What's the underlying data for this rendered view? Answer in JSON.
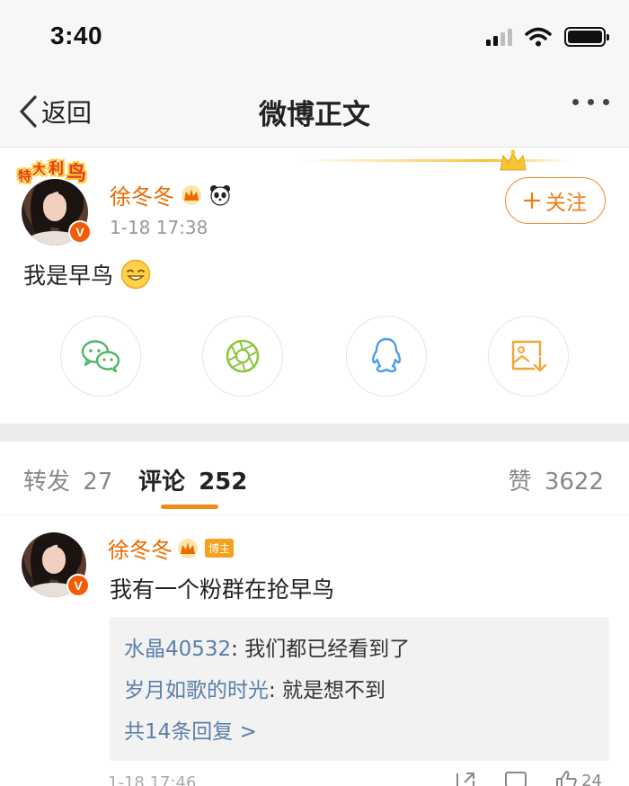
{
  "status_bar": {
    "time": "3:40"
  },
  "header": {
    "back_label": "返回",
    "title": "微博正文"
  },
  "post": {
    "sticker_text": [
      "特",
      "大",
      "利",
      "鸟"
    ],
    "author": "徐冬冬",
    "timestamp": "1-18 17:38",
    "follow_label": "关注",
    "text": "我是早鸟",
    "share_targets": [
      "wechat-icon",
      "moments-icon",
      "qq-icon",
      "save-image-icon"
    ]
  },
  "tabs": {
    "repost_label": "转发",
    "repost_count": "27",
    "comment_label": "评论",
    "comment_count": "252",
    "like_label": "赞",
    "like_count": "3622"
  },
  "comment": {
    "author": "徐冬冬",
    "badge": "博主",
    "text": "我有一个粉群在抢早鸟",
    "replies": [
      {
        "author": "水晶40532",
        "text": ": 我们都已经看到了"
      },
      {
        "author": "岁月如歌的时光",
        "text": ": 就是想不到"
      }
    ],
    "more_replies": "共14条回复 >",
    "timestamp": "1-18 17:46",
    "like_count": "24"
  },
  "colors": {
    "accent": "#ec6a00",
    "link": "#5b7fa8",
    "tab_underline": "#f28a1a"
  }
}
